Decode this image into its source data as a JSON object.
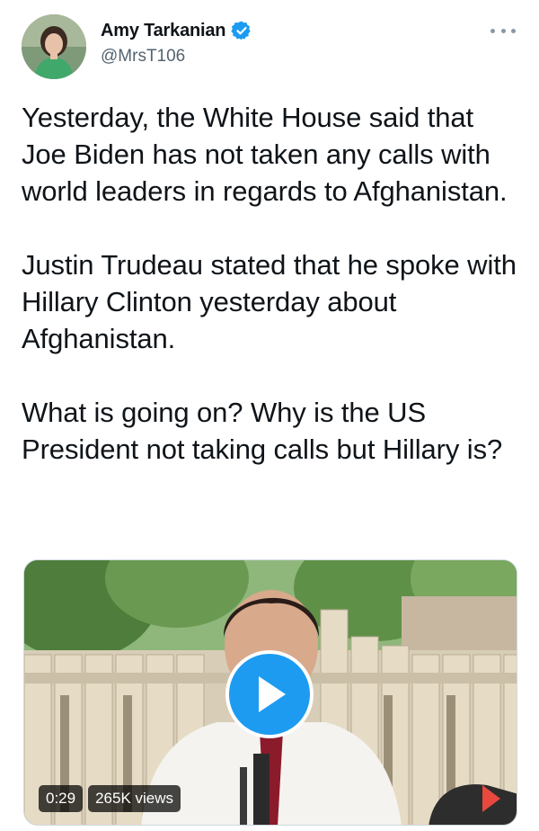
{
  "author": {
    "display_name": "Amy Tarkanian",
    "handle": "@MrsT106",
    "verified": true
  },
  "tweet": {
    "paragraphs": [
      "Yesterday, the White House said that Joe Biden has not taken any calls with world leaders in regards to Afghanistan.",
      "Justin Trudeau stated that he spoke with Hillary Clinton yesterday about Afghanistan.",
      "What is going on? Why is the US President not taking calls but Hillary is?"
    ]
  },
  "media": {
    "type": "video",
    "duration": "0:29",
    "views": "265K views"
  },
  "icons": {
    "verified": "verified-badge-icon",
    "more": "more-options-icon",
    "play": "play-icon"
  },
  "colors": {
    "accent": "#1d9bf0",
    "text": "#0f1419",
    "secondary": "#536471"
  }
}
